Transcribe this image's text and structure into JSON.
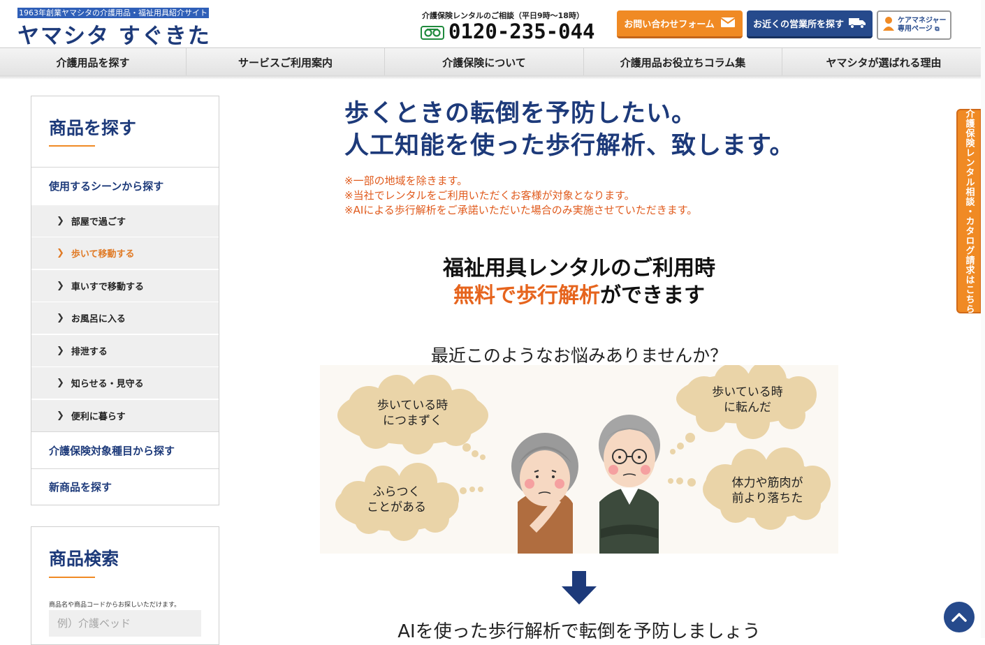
{
  "header": {
    "tagline": "1963年創業ヤマシタの介護用品・福祉用具紹介サイト",
    "logo": "ヤマシタ すぐきた",
    "consult_label": "介護保険レンタルのご相談（平日9時〜18時）",
    "freedial_icon": "freedial-icon",
    "phone": "0120-235-044",
    "contact_button": "お問い合わせフォーム",
    "office_button": "お近くの営業所を探す",
    "care_manager_line1": "ケアマネジャー",
    "care_manager_line2": "専用ページ",
    "colors": {
      "brand": "#1d3a7a",
      "accent": "#f08a24",
      "navy": "#264a8c"
    }
  },
  "nav": {
    "items": [
      "介護用品を探す",
      "サービスご利用案内",
      "介護保険について",
      "介護用品お役立ちコラム集",
      "ヤマシタが選ばれる理由"
    ]
  },
  "sidebar": {
    "title": "商品を探す",
    "scene_section": "使用するシーンから探す",
    "scenes": [
      {
        "label": "部屋で過ごす",
        "active": false
      },
      {
        "label": "歩いて移動する",
        "active": true
      },
      {
        "label": "車いすで移動する",
        "active": false
      },
      {
        "label": "お風呂に入る",
        "active": false
      },
      {
        "label": "排泄する",
        "active": false
      },
      {
        "label": "知らせる・見守る",
        "active": false
      },
      {
        "label": "便利に暮らす",
        "active": false
      }
    ],
    "insurance_section": "介護保険対象種目から探す",
    "new_section": "新商品を探す"
  },
  "search": {
    "title": "商品検索",
    "hint": "商品名や商品コードからお探しいただけます。",
    "placeholder": "例）介護ベッド"
  },
  "main": {
    "headline_line1": "歩くときの転倒を予防したい。",
    "headline_line2": "人工知能を使った歩行解析、致します。",
    "notes": [
      "※一部の地域を除きます。",
      "※当社でレンタルをご利用いただくお客様が対象となります。",
      "※AIによる歩行解析をご承諾いただいた場合のみ実施させていただきます。"
    ],
    "sub_head_line1": "福祉用具レンタルのご利用時",
    "sub_head_orange": "無料で歩行解析",
    "sub_head_rest": "ができます",
    "worry_title": "最近このようなお悩みありませんか？",
    "bubbles": [
      {
        "line1": "歩いている時",
        "line2": "につまずく"
      },
      {
        "line1": "ふらつく",
        "line2": "ことがある"
      },
      {
        "line1": "歩いている時",
        "line2": "に転んだ"
      },
      {
        "line1": "体力や筋肉が",
        "line2": "前より落ちた"
      }
    ],
    "ai_text": "AIを使った歩行解析で転倒を予防しましょう"
  },
  "side_tab": "介護保険レンタル相談・カタログ請求はこちら"
}
